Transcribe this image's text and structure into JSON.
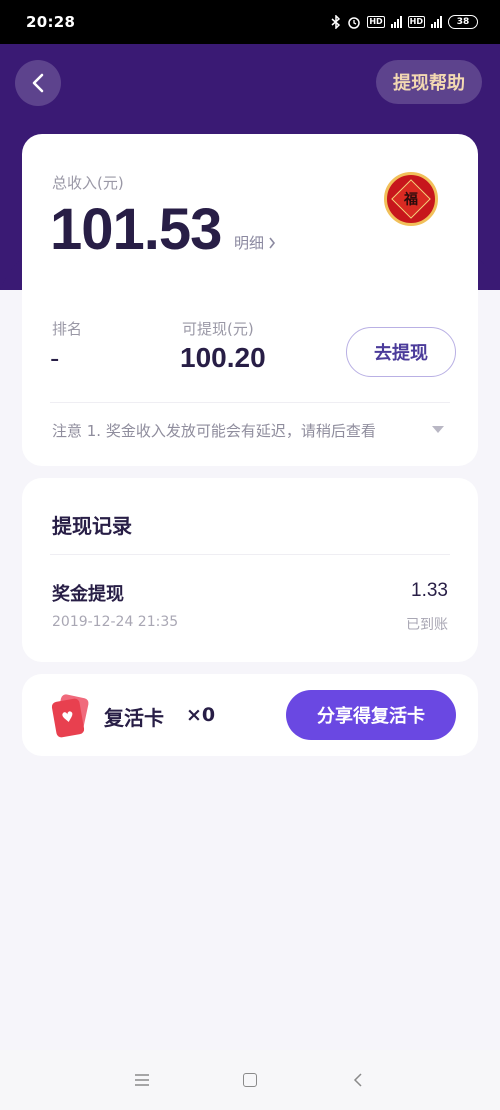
{
  "status_bar": {
    "time": "20:28",
    "battery": "38",
    "network": "4G"
  },
  "header": {
    "help_label": "提现帮助"
  },
  "income": {
    "total_label": "总收入(元)",
    "total_value": "101.53",
    "detail_label": "明细",
    "badge_char": "福",
    "rank_label": "排名",
    "rank_value": "-",
    "withdrawable_label": "可提现(元)",
    "withdrawable_value": "100.20",
    "withdraw_button": "去提现",
    "notice": "注意  1. 奖金收入发放可能会有延迟，请稍后查看"
  },
  "records": {
    "title": "提现记录",
    "items": [
      {
        "name": "奖金提现",
        "time": "2019-12-24 21:35",
        "amount": "1.33",
        "status": "已到账"
      }
    ]
  },
  "revive": {
    "label": "复活卡",
    "count": "×0",
    "share_button": "分享得复活卡"
  },
  "colors": {
    "header_purple": "#3a1a74",
    "accent_purple": "#6a48e2",
    "help_text": "#f3d9b2",
    "text_dark": "#281e46"
  },
  "icons": [
    "bluetooth-icon",
    "alarm-icon",
    "signal-icon",
    "battery-icon",
    "back-arrow-icon",
    "chevron-right-icon",
    "fu-badge-icon",
    "dropdown-arrow-icon",
    "revive-card-icon",
    "menu-icon",
    "home-icon",
    "back-nav-icon"
  ]
}
